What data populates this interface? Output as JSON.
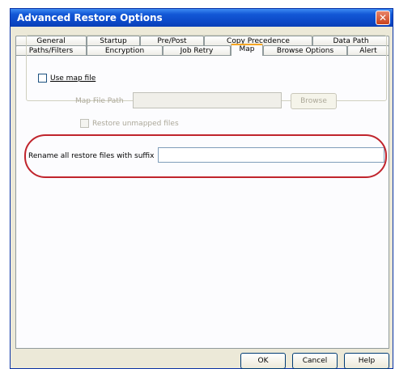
{
  "window": {
    "title": "Advanced Restore Options",
    "close_glyph": "✕"
  },
  "tabs": {
    "row1": [
      "General",
      "Startup",
      "Pre/Post",
      "Copy Precedence",
      "Data Path"
    ],
    "row2": [
      "Paths/Filters",
      "Encryption",
      "Job Retry",
      "Map",
      "Browse Options",
      "Alert"
    ],
    "active": "Map"
  },
  "map_panel": {
    "use_map_file_label": "Use map file",
    "use_map_file_checked": false,
    "map_file_path_label": "Map File Path",
    "map_file_path_value": "",
    "browse_label": "Browse",
    "restore_unmapped_label": "Restore unmapped files",
    "restore_unmapped_checked": false,
    "suffix_label": "Rename all restore files with suffix",
    "suffix_value": ""
  },
  "footer": {
    "ok_label": "OK",
    "cancel_label": "Cancel",
    "help_label": "Help"
  },
  "colors": {
    "title_bar": "#0c49c8",
    "dialog_bg": "#ece9d8",
    "highlight": "#c0242c",
    "active_tab_accent": "#f5a623"
  },
  "icons": {
    "close": "close-icon"
  }
}
